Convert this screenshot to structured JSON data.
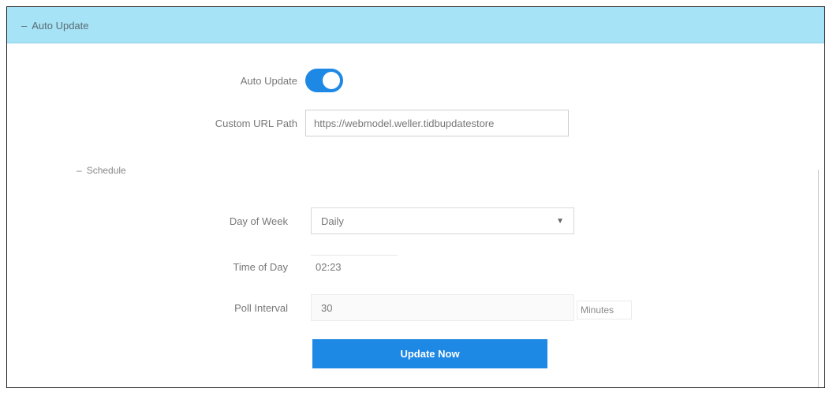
{
  "header": {
    "toggle_icon": "minus-icon",
    "title": "Auto Update"
  },
  "auto_update": {
    "label": "Auto Update",
    "enabled": true
  },
  "custom_url": {
    "label": "Custom URL Path",
    "value": "https://webmodel.weller.tidbupdatestore"
  },
  "schedule": {
    "toggle_icon": "minus-icon",
    "label": "Schedule",
    "day_of_week": {
      "label": "Day of Week",
      "value": "Daily",
      "icon": "caret-down-icon"
    },
    "time_of_day": {
      "label": "Time of Day",
      "value": "02:23"
    },
    "poll_interval": {
      "label": "Poll Interval",
      "value": "30",
      "unit": "Minutes"
    }
  },
  "update_button": {
    "label": "Update Now"
  },
  "colors": {
    "header_bg": "#a6e3f6",
    "accent": "#1e88e5"
  }
}
